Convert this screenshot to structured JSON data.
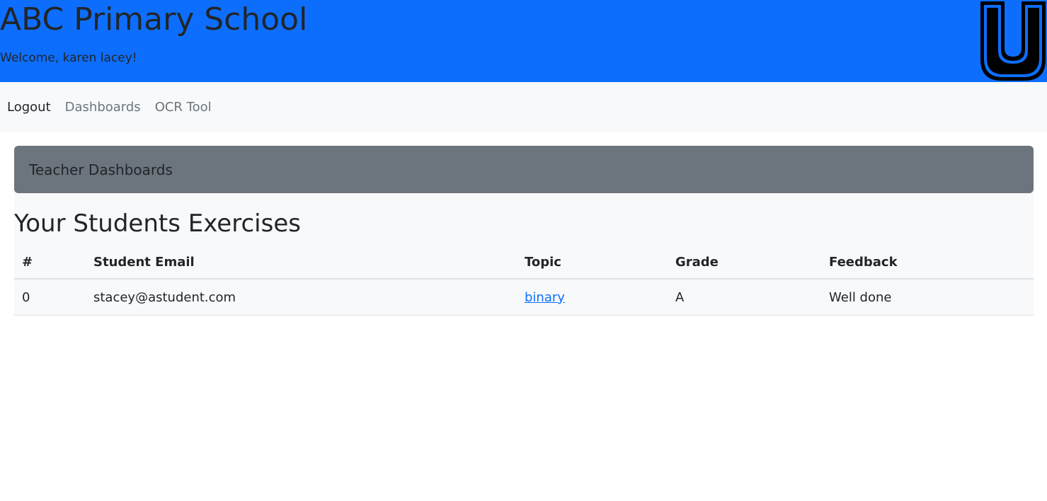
{
  "header": {
    "title": "ABC Primary School",
    "welcome": "Welcome, karen lacey!",
    "logo_icon": "letter-u-logo-icon",
    "background_color": "#0d6efd"
  },
  "nav": {
    "items": [
      {
        "label": "Logout"
      },
      {
        "label": "Dashboards"
      },
      {
        "label": "OCR Tool"
      }
    ]
  },
  "dashboard": {
    "banner_title": "Teacher Dashboards",
    "section_title": "Your Students Exercises",
    "table": {
      "columns": [
        "#",
        "Student Email",
        "Topic",
        "Grade",
        "Feedback"
      ],
      "rows": [
        {
          "num": "0",
          "email": "stacey@astudent.com",
          "topic": "binary",
          "grade": "A",
          "feedback": "Well done"
        }
      ]
    }
  },
  "colors": {
    "primary": "#0d6efd",
    "banner_gray": "#6c757d",
    "light_bg": "#f8f9fa"
  }
}
